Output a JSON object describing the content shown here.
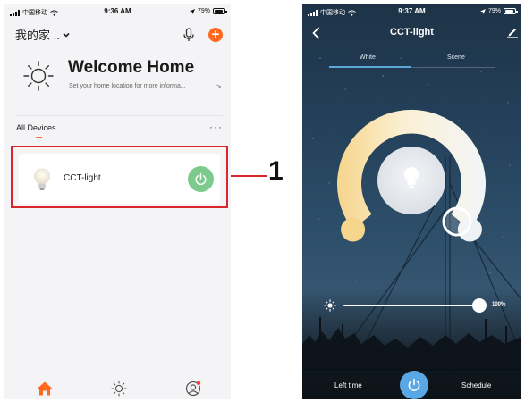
{
  "left_screen": {
    "status_bar": {
      "carrier": "中国移动",
      "time": "9:36 AM",
      "battery": "79%",
      "battery_level": 0.79
    },
    "header": {
      "home_name": "我的家 ..",
      "chevron": "chevron-down-icon",
      "mic_icon": "mic-icon",
      "add_icon": "add-icon"
    },
    "welcome": {
      "title": "Welcome Home",
      "subtitle": "Set your home location for more informa...",
      "chevron": ">"
    },
    "devices_tab": {
      "label": "All Devices",
      "more": "···"
    },
    "device": {
      "name": "CCT-light",
      "icon": "bulb-icon",
      "power_color": "#7ccb8c"
    },
    "tabbar": {
      "home_icon": "home-icon",
      "scene_icon": "sun-icon",
      "me_icon": "user-icon",
      "active_color": "#ff6a20"
    }
  },
  "annotation": {
    "number": "1",
    "color": "#d8262b"
  },
  "right_screen": {
    "status_bar": {
      "carrier": "中国移动",
      "time": "9:37 AM",
      "battery": "79%",
      "battery_level": 0.79
    },
    "header": {
      "title": "CCT-light"
    },
    "tabs": {
      "white": "White",
      "scene": "Scene",
      "active": "White"
    },
    "brightness": {
      "value_label": "100%",
      "level": 1.0
    },
    "bottom": {
      "left_time": "Left time",
      "schedule": "Schedule",
      "power_color": "#5aa7e6"
    }
  }
}
